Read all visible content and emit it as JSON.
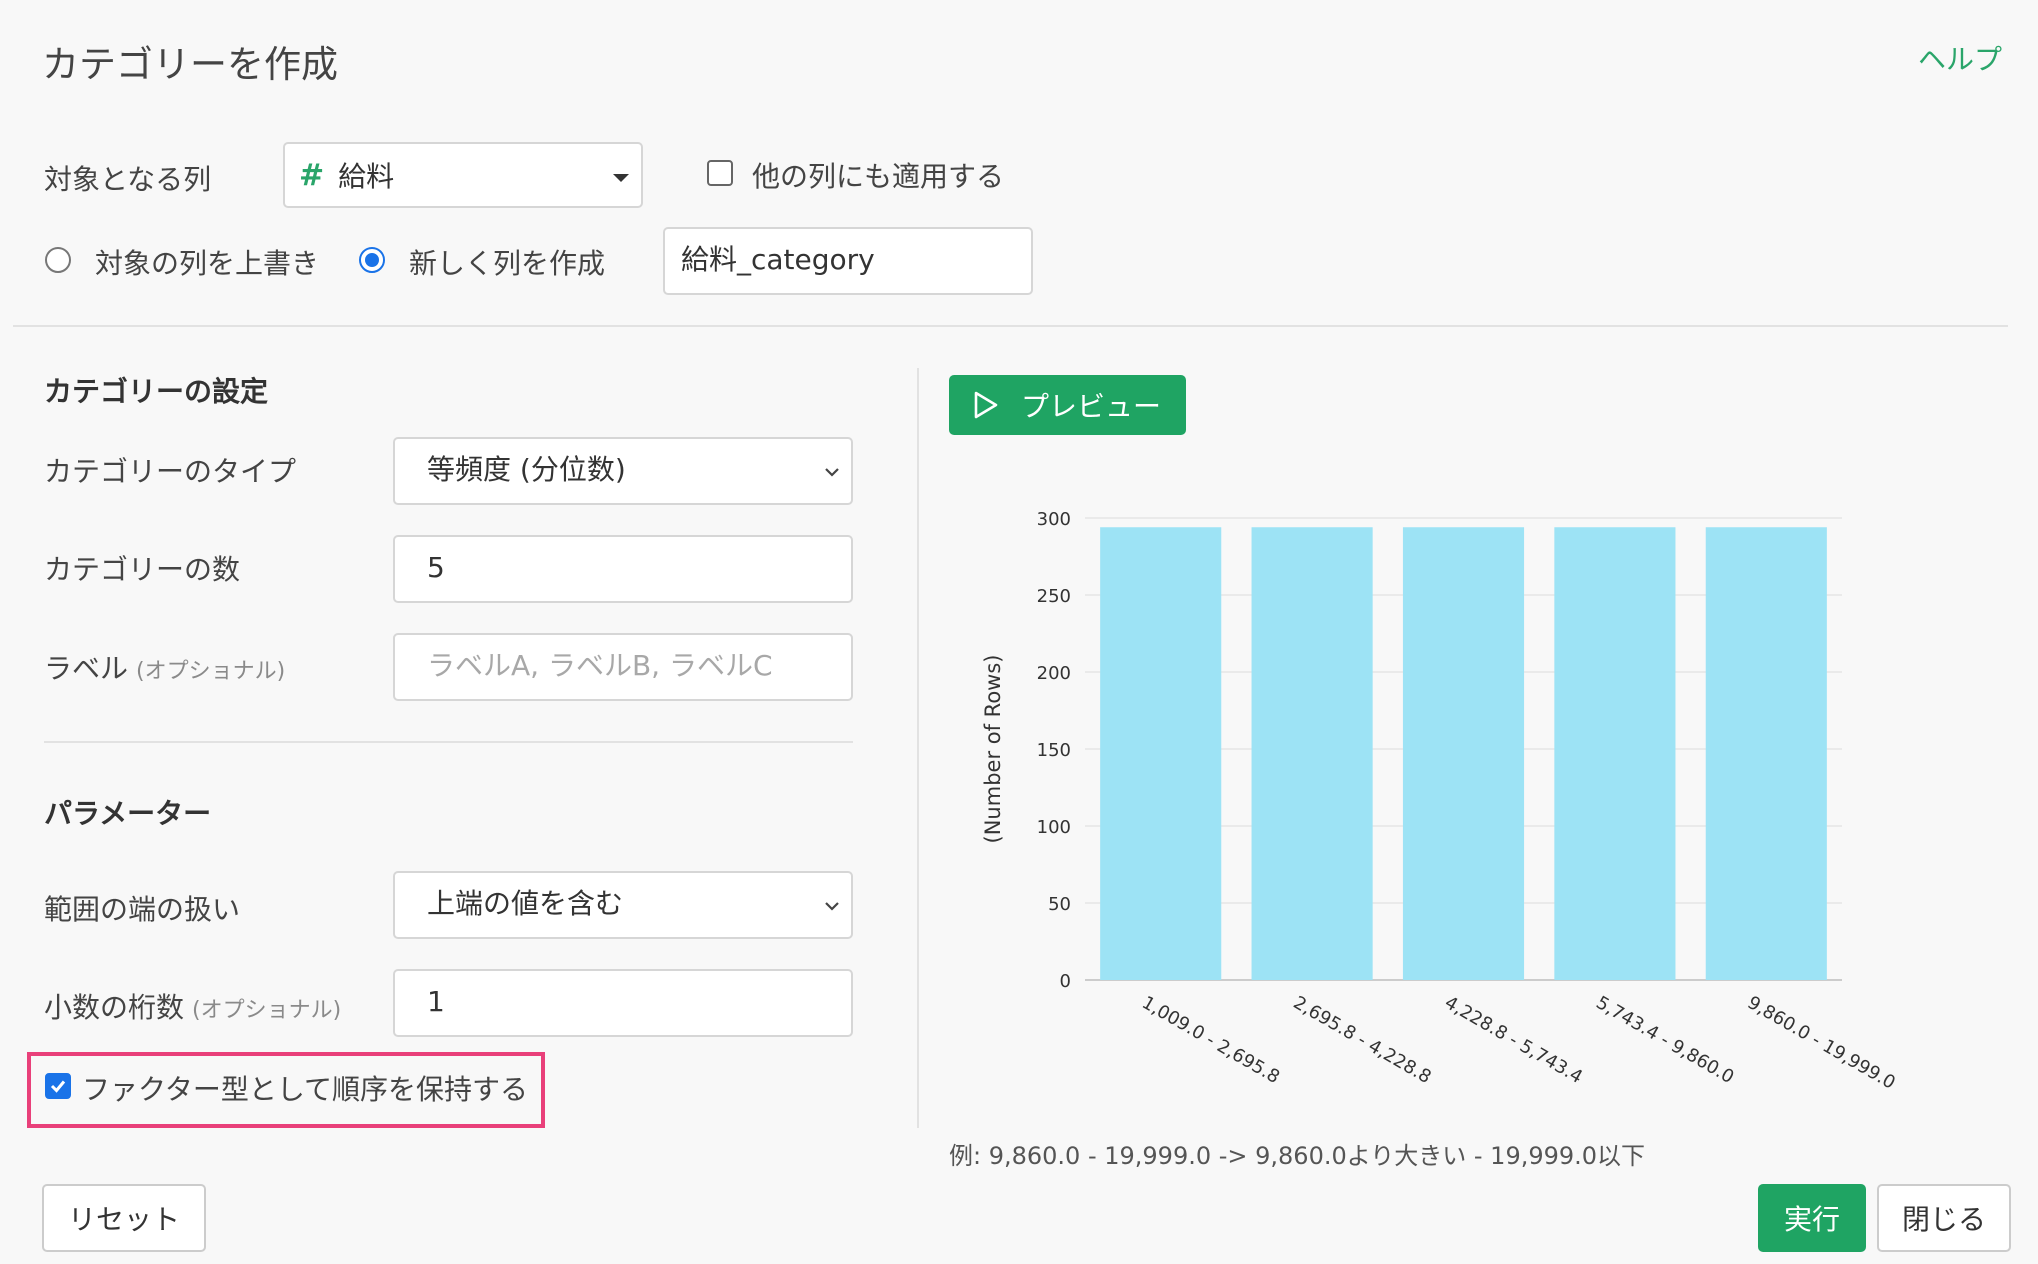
{
  "dialog": {
    "title": "カテゴリーを作成",
    "help": "ヘルプ"
  },
  "target": {
    "label": "対象となる列",
    "column": "給料",
    "apply_others": "他の列にも適用する",
    "apply_others_checked": false,
    "overwrite_label": "対象の列を上書き",
    "new_column_label": "新しく列を作成",
    "new_column_selected": true,
    "new_column_name": "給料_category"
  },
  "category_settings": {
    "title": "カテゴリーの設定",
    "type_label": "カテゴリーのタイプ",
    "type_value": "等頻度 (分位数)",
    "count_label": "カテゴリーの数",
    "count_value": "5",
    "labels_label": "ラベル",
    "optional": "(オプショナル)",
    "labels_placeholder": "ラベルA, ラベルB, ラベルC"
  },
  "parameters": {
    "title": "パラメーター",
    "edge_label": "範囲の端の扱い",
    "edge_value": "上端の値を含む",
    "decimals_label": "小数の桁数",
    "decimals_value": "1",
    "factor_label": "ファクター型として順序を保持する",
    "factor_checked": true
  },
  "preview": {
    "button": "プレビュー",
    "example": "例: 9,860.0 - 19,999.0 -> 9,860.0より大きい - 19,999.0以下"
  },
  "footer": {
    "reset": "リセット",
    "run": "実行",
    "close": "閉じる"
  },
  "colors": {
    "accent": "#1fa463",
    "bar": "#9de3f5",
    "highlight": "#e9407a",
    "link": "#2aa56a"
  },
  "chart_data": {
    "type": "bar",
    "categories": [
      "1,009.0 - 2,695.8",
      "2,695.8 - 4,228.8",
      "4,228.8 - 5,743.4",
      "5,743.4 - 9,860.0",
      "9,860.0 - 19,999.0"
    ],
    "values": [
      294,
      294,
      294,
      294,
      294
    ],
    "ylabel": "(Number of Rows)",
    "ylim": [
      0,
      300
    ],
    "yticks": [
      0,
      50,
      100,
      150,
      200,
      250,
      300
    ],
    "grid": true
  }
}
